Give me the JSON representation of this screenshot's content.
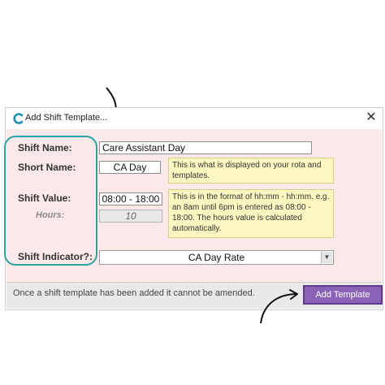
{
  "dialog": {
    "title": "Add Shift Template...",
    "close_symbol": "✕",
    "icon": "app-logo-icon"
  },
  "form": {
    "shift_name_label": "Shift Name:",
    "shift_name_value": "Care Assistant Day",
    "short_name_label": "Short Name:",
    "short_name_value": "CA Day",
    "short_name_help": "This is what is displayed on your rota and templates.",
    "shift_value_label": "Shift Value:",
    "shift_value_value": "08:00 - 18:00",
    "shift_value_help": "This is in the format of hh:mm - hh:mm. e.g. an 8am until 6pm is entered as 08:00 - 18:00.  The hours value is calculated automatically.",
    "hours_label": "Hours:",
    "hours_value": "10",
    "shift_indicator_label": "Shift Indicator?:",
    "shift_indicator_value": "CA Day Rate"
  },
  "footer": {
    "note": "Once a shift template has been added it cannot be amended.",
    "add_button_label": "Add Template"
  },
  "colors": {
    "client_background": "#fbe8e8",
    "help_background": "#fcf6c0",
    "add_button": "#8b63b6",
    "highlight_outline": "#2aa3a3",
    "annotation_arrow": "#111111"
  }
}
